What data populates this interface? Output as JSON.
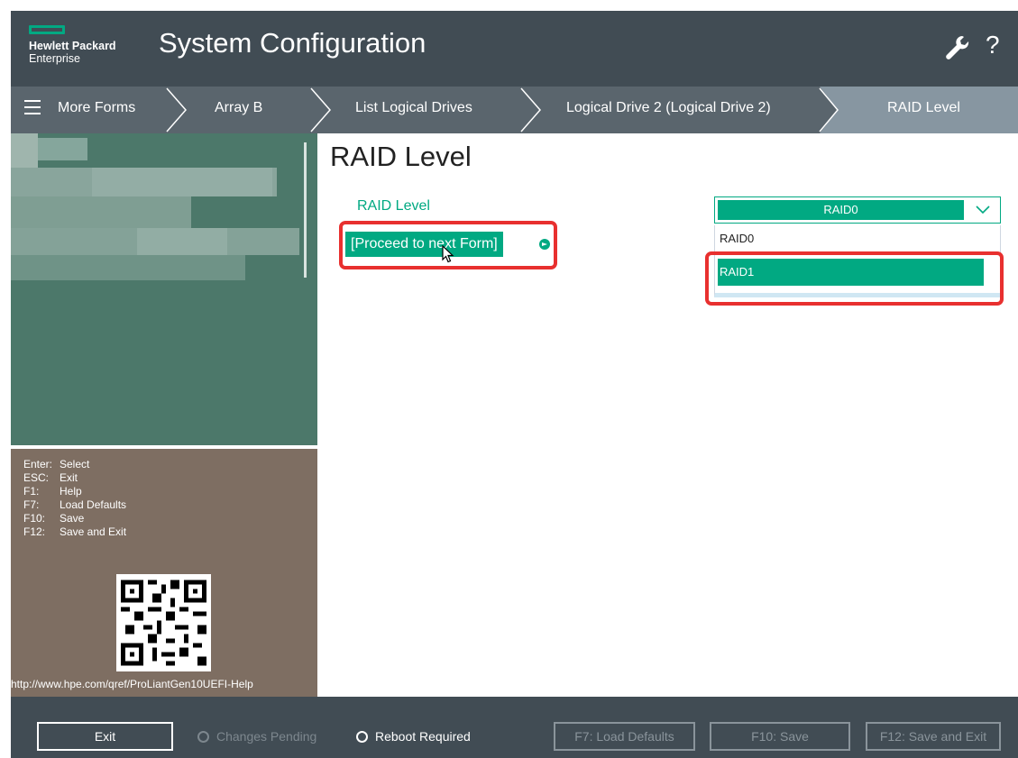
{
  "app": {
    "brand_line1": "Hewlett Packard",
    "brand_line2": "Enterprise",
    "title": "System Configuration"
  },
  "breadcrumbs": [
    {
      "label": "More Forms"
    },
    {
      "label": "Array B"
    },
    {
      "label": "List Logical Drives"
    },
    {
      "label": "Logical Drive 2 (Logical Drive 2)"
    },
    {
      "label": "RAID Level"
    }
  ],
  "help_keys": [
    {
      "key": "Enter:",
      "action": "Select"
    },
    {
      "key": "ESC:",
      "action": "Exit"
    },
    {
      "key": "F1:",
      "action": "Help"
    },
    {
      "key": "F7:",
      "action": "Load Defaults"
    },
    {
      "key": "F10:",
      "action": "Save"
    },
    {
      "key": "F12:",
      "action": "Save and Exit"
    }
  ],
  "qr_url": "http://www.hpe.com/qref/ProLiantGen10UEFI-Help",
  "form": {
    "title": "RAID Level",
    "field_label": "RAID Level",
    "proceed_label": "[Proceed to next Form]",
    "dropdown_value": "RAID0",
    "options": [
      "RAID0",
      "RAID1"
    ]
  },
  "footer": {
    "exit_label": "Exit",
    "changes_pending": "Changes Pending",
    "reboot_required": "Reboot Required",
    "load_defaults": "F7: Load Defaults",
    "save": "F10: Save",
    "save_exit": "F12: Save and Exit"
  },
  "colors": {
    "accent": "#01a982",
    "header_bg": "#414c54",
    "crumb_bg": "#5a656d",
    "left_panel_bg": "#7e6e62",
    "highlight": "#e8302f"
  }
}
